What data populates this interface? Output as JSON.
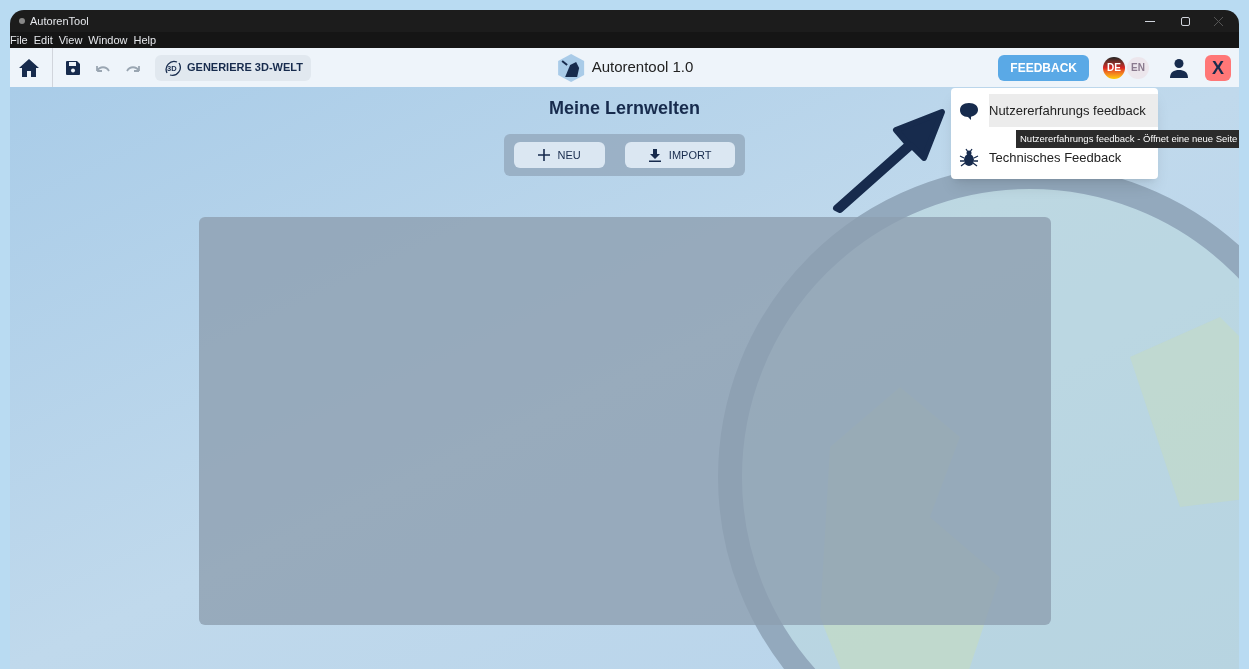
{
  "window": {
    "title": "AutorenTool"
  },
  "menu_bar": [
    "File",
    "Edit",
    "View",
    "Window",
    "Help"
  ],
  "toolbar": {
    "generate_icon_text": "3D",
    "generate_button": "GENERIERE 3D-WELT",
    "app_title": "Autorentool 1.0",
    "feedback_button": "FEEDBACK",
    "close_button": "X",
    "languages": [
      {
        "code": "DE",
        "selected": true
      },
      {
        "code": "EN",
        "selected": false
      }
    ]
  },
  "main": {
    "heading": "Meine Lernwelten",
    "buttons": [
      {
        "kind": "new",
        "label": "NEU"
      },
      {
        "kind": "import",
        "label": "IMPORT"
      }
    ]
  },
  "feedback_menu": {
    "items": [
      {
        "kind": "chat",
        "label": "Nutzererfahrungs feedback",
        "selected": true
      },
      {
        "kind": "bug",
        "label": "Technisches Feedback",
        "selected": false
      }
    ]
  },
  "tooltip": "Nutzererfahrungs feedback - Öffnet eine neue Seite"
}
